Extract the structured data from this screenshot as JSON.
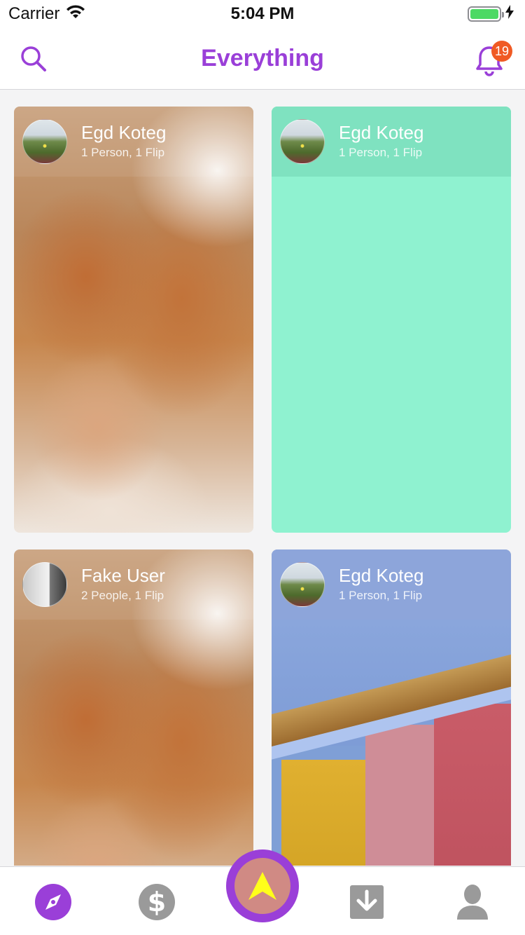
{
  "status_bar": {
    "carrier": "Carrier",
    "time": "5:04 PM"
  },
  "header": {
    "title": "Everything",
    "notification_count": "19",
    "accent_color": "#9a3fd8",
    "badge_color": "#f05a24"
  },
  "feed": {
    "cards": [
      {
        "name": "Egd Koteg",
        "subtitle": "1 Person, 1 Flip",
        "avatar": "landscape-photo",
        "image": "cat-photo"
      },
      {
        "name": "Egd Koteg",
        "subtitle": "1 Person, 1 Flip",
        "avatar": "landscape-photo",
        "image": "solid-teal",
        "color": "#8ff2d0"
      },
      {
        "name": "Fake User",
        "subtitle": "2 People, 1 Flip",
        "avatar": "office-photo",
        "image": "cat-photo"
      },
      {
        "name": "Egd Koteg",
        "subtitle": "1 Person, 1 Flip",
        "avatar": "landscape-photo",
        "image": "house-photo"
      }
    ]
  },
  "tabbar": {
    "items": [
      {
        "icon": "compass-icon",
        "active": true
      },
      {
        "icon": "dollar-icon",
        "active": false
      },
      {
        "icon": "arrow-up-icon",
        "active": false
      },
      {
        "icon": "download-icon",
        "active": false
      },
      {
        "icon": "profile-icon",
        "active": false
      }
    ]
  }
}
